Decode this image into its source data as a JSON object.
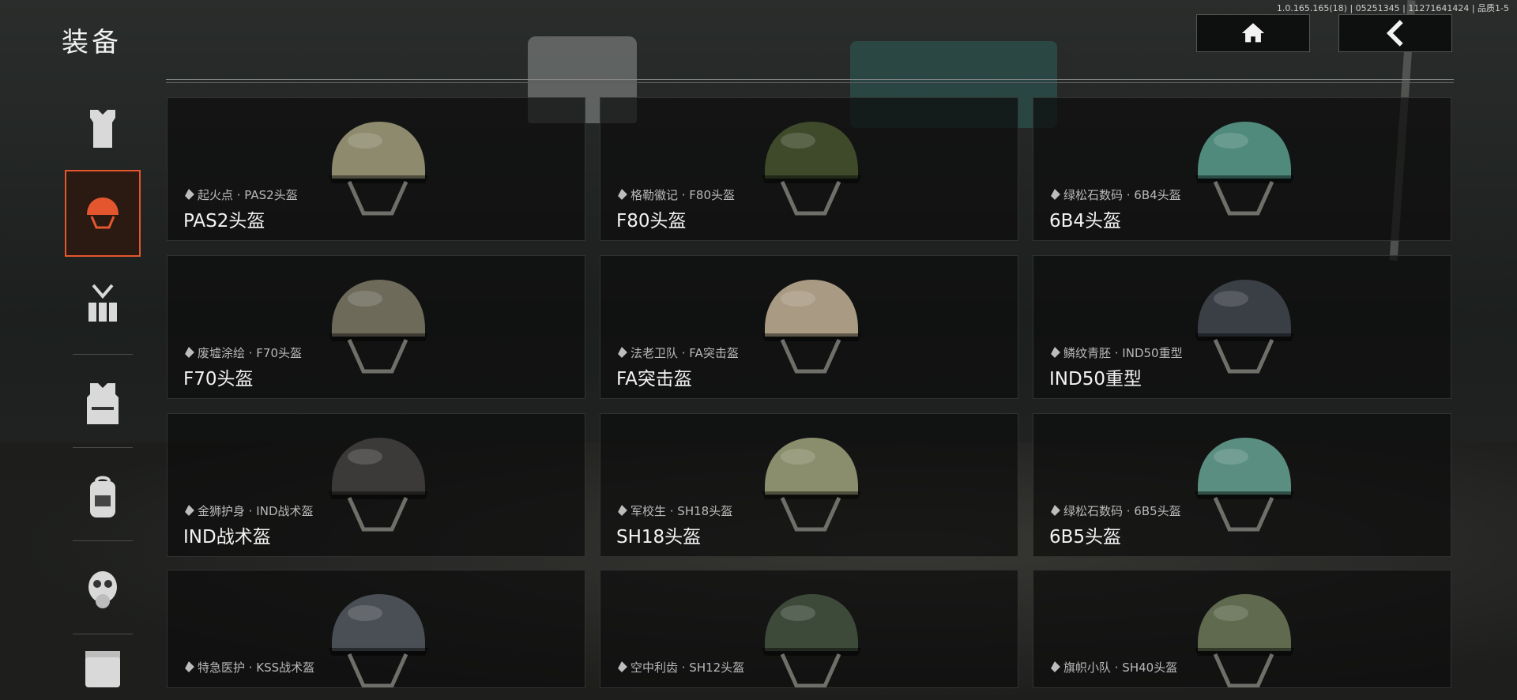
{
  "header": {
    "title": "装备",
    "version": "1.0.165.165(18) | 05251345 | 11271641424 | 品质1-5",
    "home_button_icon": "home-icon",
    "back_button_icon": "chevron-left-icon"
  },
  "sidebar": {
    "items": [
      {
        "icon": "body-armor-vest-icon",
        "active": false
      },
      {
        "icon": "helmet-icon",
        "active": true
      },
      {
        "icon": "chest-rig-icon",
        "active": false
      },
      {
        "icon": "tactical-vest-icon",
        "active": false
      },
      {
        "icon": "backpack-icon",
        "active": false
      },
      {
        "icon": "gas-mask-icon",
        "active": false
      },
      {
        "icon": "container-icon",
        "active": false
      }
    ],
    "accent_color": "#e4572e"
  },
  "items": [
    {
      "skin": "起火点 · PAS2头盔",
      "name": "PAS2头盔",
      "color": "#8d8a6e"
    },
    {
      "skin": "格勒徽记 · F80头盔",
      "name": "F80头盔",
      "color": "#3f4a2b"
    },
    {
      "skin": "绿松石数码 · 6B4头盔",
      "name": "6B4头盔",
      "color": "#4f8a7c"
    },
    {
      "skin": "废墟涂绘 · F70头盔",
      "name": "F70头盔",
      "color": "#6d6a5a"
    },
    {
      "skin": "法老卫队 · FA突击盔",
      "name": "FA突击盔",
      "color": "#a99b83"
    },
    {
      "skin": "鳞纹青胚 · IND50重型",
      "name": "IND50重型",
      "color": "#3a3f46"
    },
    {
      "skin": "金狮护身 · IND战术盔",
      "name": "IND战术盔",
      "color": "#3b3a38"
    },
    {
      "skin": "军校生 · SH18头盔",
      "name": "SH18头盔",
      "color": "#8a8e6c"
    },
    {
      "skin": "绿松石数码 · 6B5头盔",
      "name": "6B5头盔",
      "color": "#5a8e80"
    },
    {
      "skin": "特急医护 · KSS战术盔",
      "name": "",
      "color": "#4a4f55"
    },
    {
      "skin": "空中利齿 · SH12头盔",
      "name": "",
      "color": "#3d4a3a"
    },
    {
      "skin": "旗帜小队 · SH40头盔",
      "name": "",
      "color": "#5f6a4e"
    }
  ]
}
